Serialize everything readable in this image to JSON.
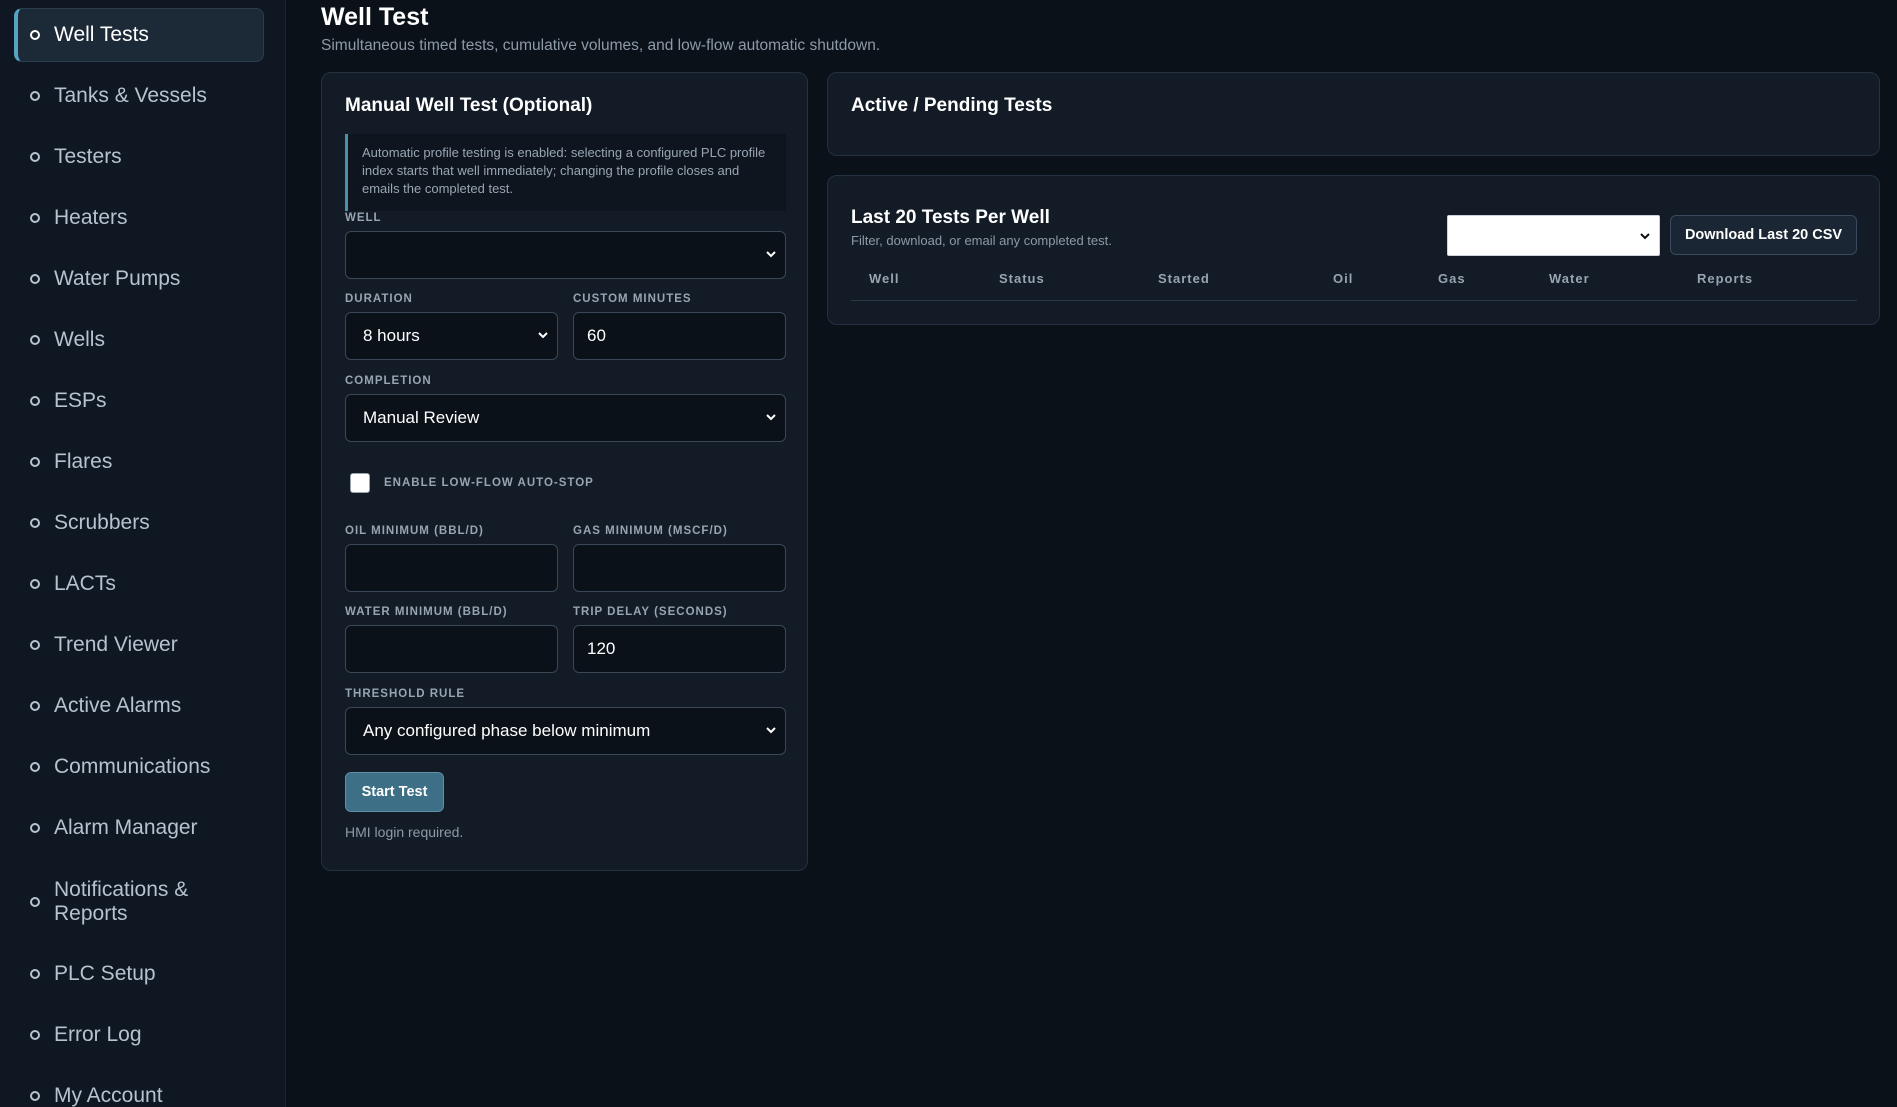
{
  "sidebar": {
    "items": [
      {
        "label": "Well Tests",
        "active": true
      },
      {
        "label": "Tanks & Vessels"
      },
      {
        "label": "Testers"
      },
      {
        "label": "Heaters"
      },
      {
        "label": "Water Pumps"
      },
      {
        "label": "Wells"
      },
      {
        "label": "ESPs"
      },
      {
        "label": "Flares"
      },
      {
        "label": "Scrubbers"
      },
      {
        "label": "LACTs"
      },
      {
        "label": "Trend Viewer"
      },
      {
        "label": "Active Alarms"
      },
      {
        "label": "Communications"
      },
      {
        "label": "Alarm Manager"
      },
      {
        "label": "Notifications & Reports"
      },
      {
        "label": "PLC Setup"
      },
      {
        "label": "Error Log"
      },
      {
        "label": "My Account"
      }
    ]
  },
  "header": {
    "title": "Well Test",
    "subtitle": "Simultaneous timed tests, cumulative volumes, and low-flow automatic shutdown."
  },
  "manual_test": {
    "title": "Manual Well Test (Optional)",
    "info": "Automatic profile testing is enabled: selecting a configured PLC profile index starts that well immediately; changing the profile closes and emails the completed test.",
    "well_label": "Well",
    "well_value": "",
    "duration_label": "Duration",
    "duration_value": "8 hours",
    "custom_minutes_label": "Custom Minutes",
    "custom_minutes_value": "60",
    "completion_label": "Completion",
    "completion_value": "Manual Review",
    "low_flow_label": "Enable Low-Flow Auto-Stop",
    "low_flow_checked": false,
    "oil_min_label": "Oil Minimum (BBL/D)",
    "oil_min_value": "",
    "gas_min_label": "Gas Minimum (MSCF/D)",
    "gas_min_value": "",
    "water_min_label": "Water Minimum (BBL/D)",
    "water_min_value": "",
    "trip_delay_label": "Trip Delay (Seconds)",
    "trip_delay_value": "120",
    "threshold_label": "Threshold Rule",
    "threshold_value": "Any configured phase below minimum",
    "start_button": "Start Test",
    "hint": "HMI login required."
  },
  "active_tests": {
    "title": "Active / Pending Tests"
  },
  "last_tests": {
    "title": "Last 20 Tests Per Well",
    "subtitle": "Filter, download, or email any completed test.",
    "filter_value": "",
    "download_button": "Download Last 20 CSV",
    "columns": [
      "Well",
      "Status",
      "Started",
      "Oil",
      "Gas",
      "Water",
      "Reports"
    ]
  },
  "icons": {
    "nav_bullet": "circle-bullet-icon",
    "select_arrow": "chevron-down-icon"
  },
  "colors": {
    "background": "#0b1119",
    "sidebar": "#0f1722",
    "card": "#121b26",
    "accent": "#56a3c4",
    "primary_button": "#3d6f86"
  }
}
